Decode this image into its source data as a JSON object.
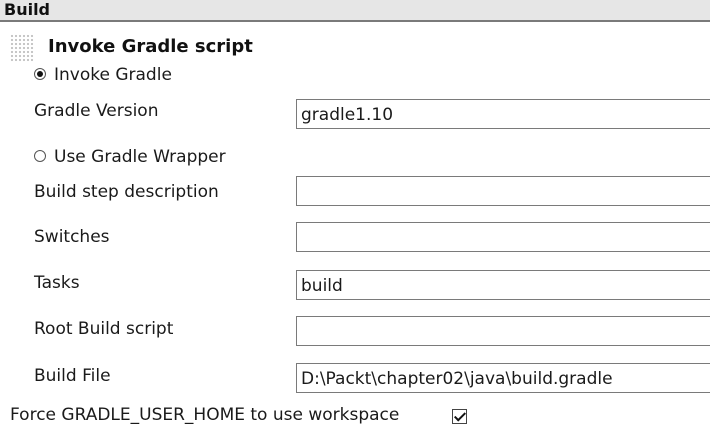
{
  "section": {
    "title": "Build"
  },
  "build_step": {
    "title": "Invoke Gradle script",
    "options": {
      "invoke_gradle": {
        "label": "Invoke Gradle",
        "selected": true
      },
      "use_wrapper": {
        "label": "Use Gradle Wrapper",
        "selected": false
      }
    },
    "fields": {
      "gradle_version": {
        "label": "Gradle Version",
        "value": "gradle1.10"
      },
      "description": {
        "label": "Build step description",
        "value": ""
      },
      "switches": {
        "label": "Switches",
        "value": ""
      },
      "tasks": {
        "label": "Tasks",
        "value": "build"
      },
      "root_build_script": {
        "label": "Root Build script",
        "value": ""
      },
      "build_file": {
        "label": "Build File",
        "value": "D:\\Packt\\chapter02\\java\\build.gradle"
      }
    },
    "force_home": {
      "label": "Force GRADLE_USER_HOME to use workspace",
      "checked": true
    }
  },
  "icons": {
    "drag_handle": "grip-dots-icon"
  },
  "colors": {
    "header_background": "#e6e6e6",
    "header_border": "#7a7a7a",
    "input_border": "#7a7a7a"
  }
}
